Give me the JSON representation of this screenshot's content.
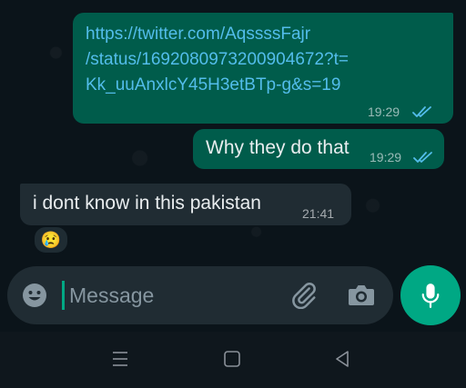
{
  "messages": [
    {
      "direction": "outgoing",
      "type": "link",
      "text": "https://twitter.com/AqssssFajr/status/1692080973200904672?t=Kk_uuAnxlcY45H3etBTp-g&s=19",
      "lines": [
        "https://twitter.com/AqssssFajr",
        "/status/1692080973200904672?t=",
        "Kk_uuAnxlcY45H3etBTp-g&s=19"
      ],
      "time": "19:29",
      "status": "read"
    },
    {
      "direction": "outgoing",
      "type": "text",
      "text": "Why they do that",
      "time": "19:29",
      "status": "read"
    },
    {
      "direction": "incoming",
      "type": "text",
      "text": "i dont know in this pakistan",
      "time": "21:41",
      "reaction": "😢"
    }
  ],
  "input": {
    "placeholder": "Message",
    "emoji_icon": "emoji-icon",
    "attach_icon": "paperclip-icon",
    "camera_icon": "camera-icon"
  },
  "mic_button": {
    "icon": "microphone-icon"
  },
  "navbar": {
    "items": [
      "menu-icon",
      "home-icon",
      "back-icon"
    ]
  },
  "colors": {
    "background": "#0b141a",
    "outgoing_bubble": "#005c4b",
    "incoming_bubble": "#202c33",
    "link": "#53bdeb",
    "read_ticks": "#53bdeb",
    "accent": "#00a884"
  }
}
